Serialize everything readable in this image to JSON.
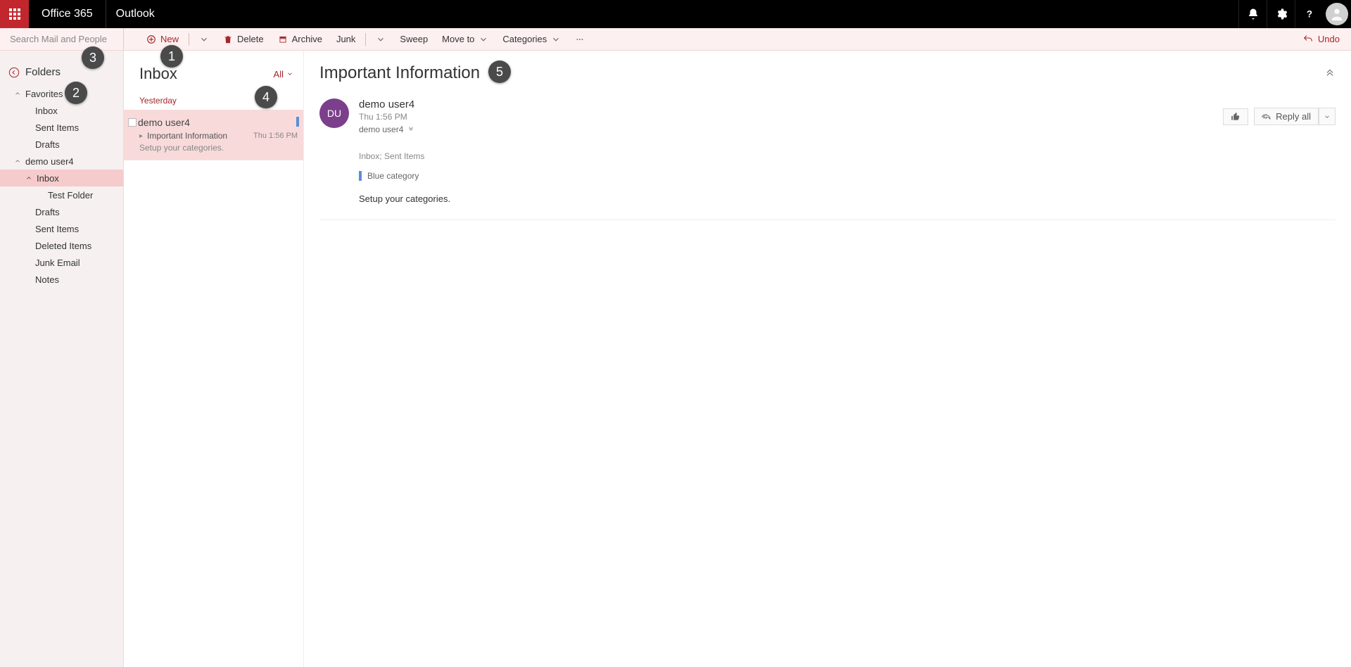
{
  "topbar": {
    "brand": "Office 365",
    "app": "Outlook"
  },
  "toolbar": {
    "search_placeholder": "Search Mail and People",
    "new": "New",
    "delete": "Delete",
    "archive": "Archive",
    "junk": "Junk",
    "sweep": "Sweep",
    "moveto": "Move to",
    "categories": "Categories",
    "undo": "Undo"
  },
  "sidebar": {
    "folders": "Folders",
    "favorites": "Favorites",
    "fav_items": [
      "Inbox",
      "Sent Items",
      "Drafts"
    ],
    "account": "demo user4",
    "inbox": "Inbox",
    "test_folder": "Test Folder",
    "drafts": "Drafts",
    "sent": "Sent Items",
    "deleted": "Deleted Items",
    "junk": "Junk Email",
    "notes": "Notes"
  },
  "msglist": {
    "title": "Inbox",
    "filter": "All",
    "date_sep": "Yesterday",
    "items": [
      {
        "from": "demo user4",
        "subject": "Important Information",
        "time": "Thu 1:56 PM",
        "preview": "Setup your categories."
      }
    ]
  },
  "reading": {
    "subject": "Important Information",
    "sender_initials": "DU",
    "sender_name": "demo user4",
    "sender_time": "Thu 1:56 PM",
    "sender_to": "demo user4",
    "location": "Inbox; Sent Items",
    "category": "Blue category",
    "body": "Setup your categories.",
    "reply_all": "Reply all"
  },
  "annotations": {
    "a1": "1",
    "a2": "2",
    "a3": "3",
    "a4": "4",
    "a5": "5"
  }
}
